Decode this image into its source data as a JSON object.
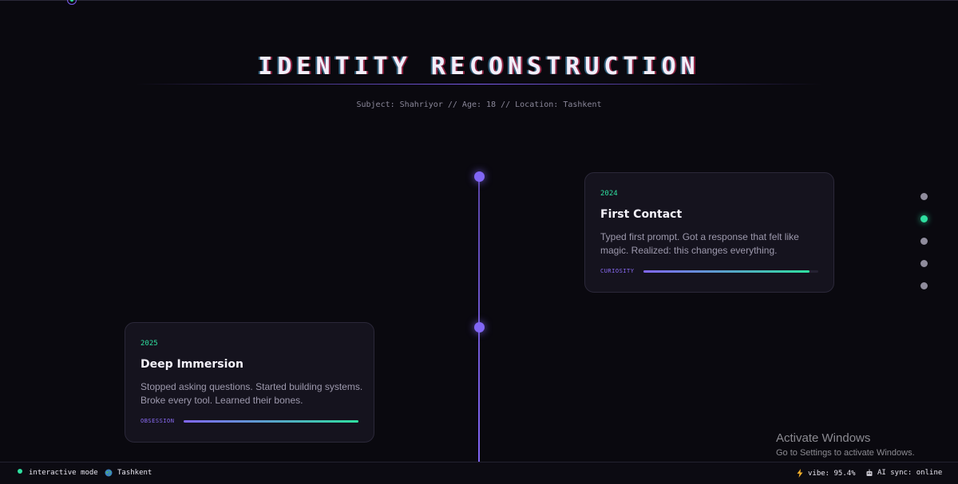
{
  "header": {
    "title": "IDENTITY RECONSTRUCTION",
    "subtitle": "Subject: Shahriyor // Age: 18 // Location: Tashkent"
  },
  "timeline": {
    "entries": [
      {
        "year": "2024",
        "title": "First Contact",
        "text": "Typed first prompt. Got a response that felt like magic. Realized: this changes everything.",
        "meter_label": "CURIOSITY",
        "meter_level": 0.95
      },
      {
        "year": "2025",
        "title": "Deep Immersion",
        "text": "Stopped asking questions. Started building systems. Broke every tool. Learned their bones.",
        "meter_label": "OBSESSION",
        "meter_level": 1.0
      }
    ]
  },
  "side_nav": {
    "count": 5,
    "active_index": 1
  },
  "status_bar": {
    "mode": "interactive mode",
    "location": "Tashkent",
    "vibe": "vibe: 95.4%",
    "ai_sync": "AI sync: online"
  },
  "watermark": {
    "title": "Activate Windows",
    "subtitle": "Go to Settings to activate Windows."
  },
  "colors": {
    "accent_purple": "#8166f5",
    "accent_green": "#2fe0a0",
    "background": "#0a090f",
    "card_bg": "#15131e"
  }
}
